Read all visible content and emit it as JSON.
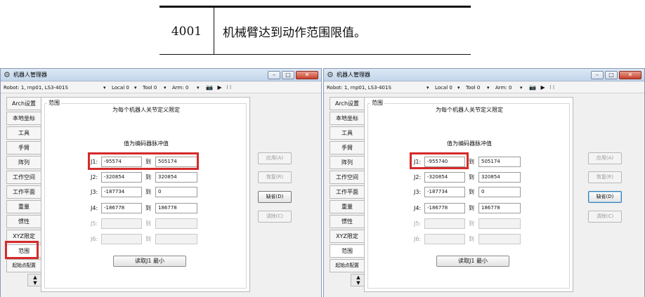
{
  "error": {
    "code": "4001",
    "message": "机械臂达到动作范围限值。"
  },
  "window": {
    "title": "机器人管理器",
    "minimize": "–",
    "maximize": "□",
    "close": "✕"
  },
  "toolbar": {
    "robot": "Robot: 1, rnp01, LS3-401S",
    "local": "Local 0",
    "tool": "Tool 0",
    "arm": "Arm: 0",
    "icons": "📷 ▶ ⁝⁝"
  },
  "tabs": [
    "Arch设置",
    "本地坐标",
    "工具",
    "手臂",
    "阵列",
    "工作空间",
    "工作平面",
    "重量",
    "惯性",
    "XYZ限定",
    "范围",
    "起始点配置"
  ],
  "panel": {
    "group": "范围",
    "heading": "为每个机器人关节定义限定",
    "subheading": "值为编码器脉冲值",
    "to_label": "到",
    "read_button": "读取J1 最小"
  },
  "side_buttons": {
    "apply": "应用(A)",
    "restore": "恢复(R)",
    "default": "缺省(D)",
    "clear": "清除(C)"
  },
  "screens": [
    {
      "joints": [
        {
          "label": "J1:",
          "min": "-95574",
          "max": "505174"
        },
        {
          "label": "J2:",
          "min": "-320854",
          "max": "320854"
        },
        {
          "label": "J3:",
          "min": "-187734",
          "max": "0"
        },
        {
          "label": "J4:",
          "min": "-186778",
          "max": "186778"
        },
        {
          "label": "J5:",
          "min": "",
          "max": ""
        },
        {
          "label": "J6:",
          "min": "",
          "max": ""
        }
      ]
    },
    {
      "joints": [
        {
          "label": "J1:",
          "min": "-955740",
          "max": "505174"
        },
        {
          "label": "J2:",
          "min": "-320854",
          "max": "320854"
        },
        {
          "label": "J3:",
          "min": "-187734",
          "max": "0"
        },
        {
          "label": "J4:",
          "min": "-186778",
          "max": "186778"
        },
        {
          "label": "J5:",
          "min": "",
          "max": ""
        },
        {
          "label": "J6:",
          "min": "",
          "max": ""
        }
      ]
    }
  ],
  "colors": {
    "highlight": "#d52a2a",
    "titlebar": "#c2d5ea",
    "focus": "#3c7fb1"
  }
}
